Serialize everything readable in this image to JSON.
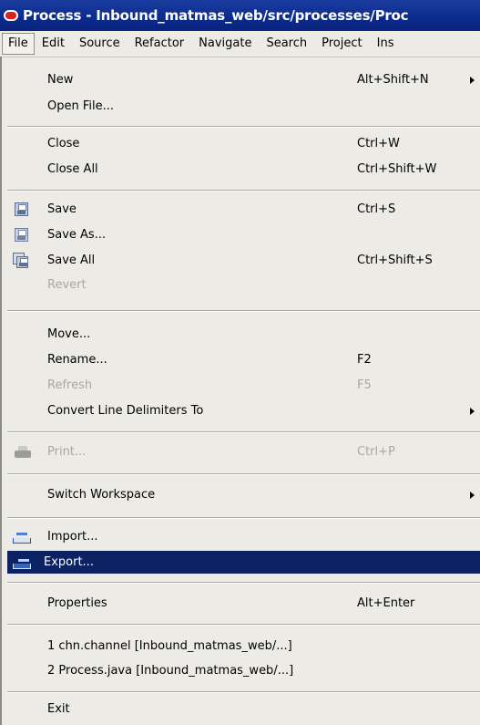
{
  "window": {
    "title": "Process - Inbound_matmas_web/src/processes/Proc"
  },
  "menubar": {
    "items": [
      "File",
      "Edit",
      "Source",
      "Refactor",
      "Navigate",
      "Search",
      "Project",
      "Ins"
    ]
  },
  "menu": {
    "items": [
      {
        "label": "New",
        "shortcut": "Alt+Shift+N",
        "submenu": true
      },
      {
        "label": "Open File...",
        "shortcut": ""
      },
      {
        "label": "Close",
        "shortcut": "Ctrl+W"
      },
      {
        "label": "Close All",
        "shortcut": "Ctrl+Shift+W"
      },
      {
        "label": "Save",
        "shortcut": "Ctrl+S",
        "icon": "save-icon"
      },
      {
        "label": "Save As...",
        "shortcut": "",
        "icon": "save-as-icon"
      },
      {
        "label": "Save All",
        "shortcut": "Ctrl+Shift+S",
        "icon": "save-all-icon"
      },
      {
        "label": "Revert",
        "shortcut": "",
        "disabled": true
      },
      {
        "label": "Move...",
        "shortcut": ""
      },
      {
        "label": "Rename...",
        "shortcut": "F2"
      },
      {
        "label": "Refresh",
        "shortcut": "F5",
        "disabled": true
      },
      {
        "label": "Convert Line Delimiters To",
        "shortcut": "",
        "submenu": true
      },
      {
        "label": "Print...",
        "shortcut": "Ctrl+P",
        "disabled": true,
        "icon": "printer-icon"
      },
      {
        "label": "Switch Workspace",
        "shortcut": "",
        "submenu": true
      },
      {
        "label": "Import...",
        "shortcut": "",
        "icon": "import-icon"
      },
      {
        "label": "Export...",
        "shortcut": "",
        "icon": "export-icon",
        "selected": true
      },
      {
        "label": "Properties",
        "shortcut": "Alt+Enter"
      },
      {
        "label": "1 chn.channel  [Inbound_matmas_web/...]",
        "shortcut": ""
      },
      {
        "label": "2 Process.java  [Inbound_matmas_web/...]",
        "shortcut": ""
      },
      {
        "label": "Exit",
        "shortcut": ""
      }
    ]
  },
  "colors": {
    "titlebar": "#0b2a8c",
    "selection": "#0d2262",
    "menu_bg": "#ecebe6",
    "disabled_text": "#a8a7a2"
  }
}
